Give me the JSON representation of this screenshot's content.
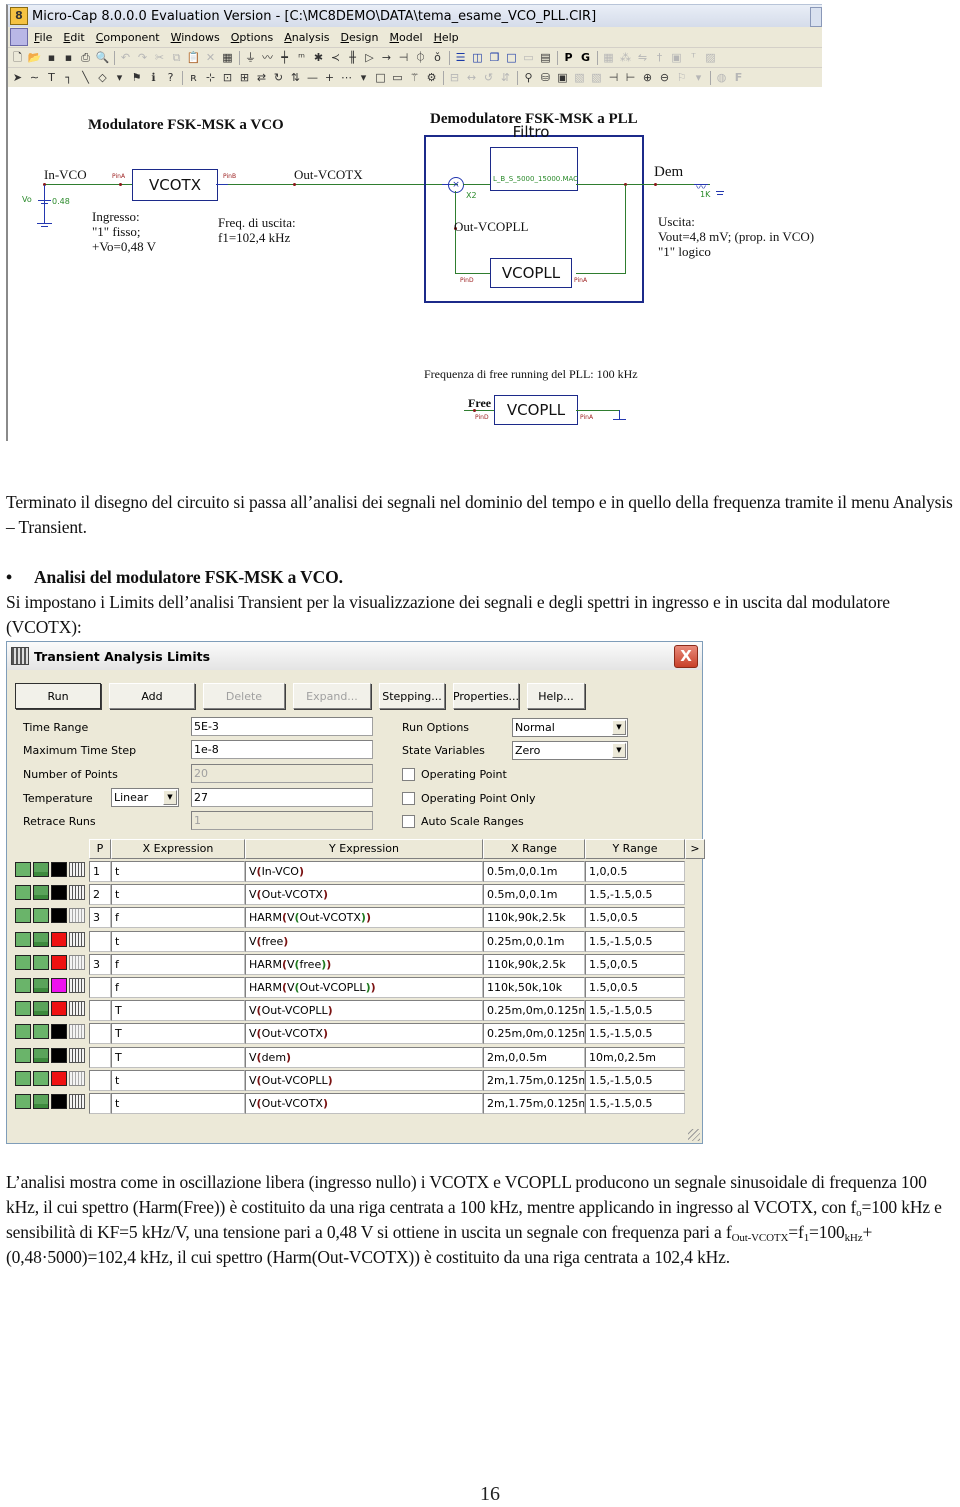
{
  "microcap": {
    "title": "Micro-Cap 8.0.0.0 Evaluation Version - [C:\\MC8DEMO\\DATA\\tema_esame_VCO_PLL.CIR]",
    "app_icon": "8",
    "menu": [
      "File",
      "Edit",
      "Component",
      "Windows",
      "Options",
      "Analysis",
      "Design",
      "Model",
      "Help"
    ],
    "toolbar1": [
      "new-icon",
      "open-icon",
      "save-icon",
      "save-as-icon",
      "print-icon",
      "print-preview-icon",
      "|",
      "undo-icon",
      "redo-icon",
      "cut-icon",
      "copy-icon",
      "paste-icon",
      "delete-icon",
      "select-all-icon",
      "|",
      "ground-icon",
      "resistor-icon",
      "capacitor-icon",
      "inductor-icon",
      "diode-icon",
      "bjt-icon",
      "mosfet-icon",
      "opamp-icon",
      "source-icon",
      "battery-icon",
      "pulse-icon",
      "jfet-icon",
      "|",
      "tile-horizontal-icon",
      "tile-vertical-icon",
      "cascade-icon",
      "window-icon",
      "window2-icon",
      "calculator-icon",
      "|",
      "P",
      "G",
      "|",
      "grid-icon",
      "pattern-icon",
      "flip-icon",
      "pin-icon",
      "box-icon",
      "text-icon",
      "picture-icon"
    ],
    "toolbar2": [
      "select-arrow-icon",
      "wire-icon",
      "text-tool-icon",
      "bus-icon",
      "line-icon",
      "shape-icon",
      "dropdown-icon",
      "flag-icon",
      "info-icon",
      "help-icon",
      "|",
      "ref-icon",
      "node-icon",
      "probe-icon",
      "attr-icon",
      "swap-icon",
      "rotate-icon",
      "mirror-icon",
      "horizontal-icon",
      "cross-icon",
      "dots-icon",
      "dropdown2-icon",
      "rect-icon",
      "page-icon",
      "wand-icon",
      "props-icon",
      "|",
      "dim1-icon",
      "dim2-icon",
      "dim3-icon",
      "dim4-icon",
      "|",
      "find-icon",
      "binoculars-icon",
      "monitor-icon",
      "dim5-icon",
      "dim6-icon",
      "pin-left-icon",
      "pin-right-icon",
      "zoom-in-icon",
      "zoom-out-icon",
      "flag2-icon",
      "dropdown3-icon",
      "|",
      "color-icon",
      "F"
    ],
    "schematic": {
      "modulator_title": "Modulatore FSK-MSK a VCO",
      "in_vco": "In-VCO",
      "vo_label": "Vo",
      "vo_value": "0.48",
      "vcotx": "VCOTX",
      "pin_a": "PinA",
      "pin_b": "PinB",
      "pin_d": "PinD",
      "out_vcotx": "Out-VCOTX",
      "ingresso": "Ingresso:\n\"1\" fisso;\n+Vo=0,48 V",
      "freq_uscita": "Freq. di uscita:\nf1=102,4 kHz",
      "demod_title": "Demodulatore FSK-MSK a PLL",
      "filtro": "Filtro",
      "filter_macro": "L_B_S_5000_15000.MAC",
      "x2": "X2",
      "dem": "Dem",
      "r_value": "1K",
      "out_vcopll": "Out-VCOPLL",
      "vcopll": "VCOPLL",
      "uscita": "Uscita:\nVout=4,8 mV; (prop. in VCO)\n\"1\" logico",
      "free_running": "Frequenza di free running del PLL: 100 kHz",
      "free": "Free"
    }
  },
  "doc": {
    "para1": "Terminato il disegno del circuito si passa all’analisi dei segnali nel dominio del tempo e in quello della frequenza tramite il menu Analysis – Transient.",
    "bullet_mark": "•",
    "bullet": "Analisi del modulatore FSK-MSK a VCO.",
    "para2": "Si impostano i Limits dell’analisi Transient per la visualizzazione dei segnali e degli spettri in ingresso e in uscita dal modulatore (VCOTX):",
    "para3_a": "L’analisi mostra come in oscillazione libera (ingresso nullo) i VCOTX e VCOPLL producono un segnale sinusoidale di frequenza 100 kHz, il cui spettro (Harm(Free)) è costituito da una riga centrata a 100 kHz, mentre applicando in ingresso al VCOTX, con f",
    "sub_o": "o",
    "para3_b": "=100 kHz e sensibilità di KF=5 kHz/V, una tensione pari a 0,48 V si ottiene in uscita un segnale con frequenza pari a f",
    "sub_out": "Out-VCOTX",
    "para3_c": "=f",
    "sub_1": "1",
    "para3_d": "=100",
    "sub_khz": "kHz",
    "para3_e": "+(0,48·5000)=102,4 kHz, il cui spettro (Harm(Out-VCOTX)) è costituito da una riga centrata a 102,4 kHz.",
    "page_number": "16"
  },
  "dialog": {
    "title": "Transient Analysis Limits",
    "close": "X",
    "buttons": [
      {
        "label": "Run",
        "state": "default"
      },
      {
        "label": "Add",
        "state": "normal"
      },
      {
        "label": "Delete",
        "state": "disabled"
      },
      {
        "label": "Expand...",
        "state": "disabled"
      },
      {
        "label": "Stepping...",
        "state": "normal"
      },
      {
        "label": "Properties...",
        "state": "normal"
      },
      {
        "label": "Help...",
        "state": "normal"
      }
    ],
    "fields": {
      "time_range": {
        "label": "Time Range",
        "value": "5E-3"
      },
      "max_time_step": {
        "label": "Maximum Time Step",
        "value": "1e-8"
      },
      "num_points": {
        "label": "Number of Points",
        "value": "20"
      },
      "temperature": {
        "label": "Temperature",
        "mode": "Linear",
        "value": "27"
      },
      "retrace_runs": {
        "label": "Retrace Runs",
        "value": "1"
      }
    },
    "run_options": {
      "label": "Run Options",
      "value": "Normal"
    },
    "state_variables": {
      "label": "State Variables",
      "value": "Zero"
    },
    "checkboxes": [
      {
        "label": "Operating Point",
        "checked": false
      },
      {
        "label": "Operating Point Only",
        "checked": false
      },
      {
        "label": "Auto Scale Ranges",
        "checked": false
      }
    ],
    "columns": {
      "p": "P",
      "x_expr": "X Expression",
      "y_expr": "Y Expression",
      "x_range": "X Range",
      "y_range": "Y Range",
      "more": ">"
    },
    "rows": [
      {
        "p": "1",
        "x": "t",
        "y": "V(In-VCO)",
        "xr": "0.5m,0,0.1m",
        "yr": "1,0,0.5",
        "color": "#000000",
        "mode": "dark"
      },
      {
        "p": "2",
        "x": "t",
        "y": "V(Out-VCOTX)",
        "xr": "0.5m,0,0.1m",
        "yr": "1.5,-1.5,0.5",
        "color": "#000000",
        "mode": "dark"
      },
      {
        "p": "3",
        "x": "f",
        "y": "HARM(V(Out-VCOTX))",
        "xr": "110k,90k,2.5k",
        "yr": "1.5,0,0.5",
        "color": "#000000",
        "mode": "dim"
      },
      {
        "p": "",
        "x": "t",
        "y": "V(free)",
        "xr": "0.25m,0,0.1m",
        "yr": "1.5,-1.5,0.5",
        "color": "#ee1111",
        "mode": "dark"
      },
      {
        "p": "3",
        "x": "f",
        "y": "HARM(V(free))",
        "xr": "110k,90k,2.5k",
        "yr": "1.5,0,0.5",
        "color": "#ee1111",
        "mode": "dim"
      },
      {
        "p": "",
        "x": "f",
        "y": "HARM(V(Out-VCOPLL))",
        "xr": "110k,50k,10k",
        "yr": "1.5,0,0.5",
        "color": "#ee11ee",
        "mode": "dark"
      },
      {
        "p": "",
        "x": "T",
        "y": "V(Out-VCOPLL)",
        "xr": "0.25m,0m,0.125m",
        "yr": "1.5,-1.5,0.5",
        "color": "#ee1111",
        "mode": "dark"
      },
      {
        "p": "",
        "x": "T",
        "y": "V(Out-VCOTX)",
        "xr": "0.25m,0m,0.125m",
        "yr": "1.5,-1.5,0.5",
        "color": "#000000",
        "mode": "dim"
      },
      {
        "p": "",
        "x": "T",
        "y": "V(dem)",
        "xr": "2m,0,0.5m",
        "yr": "10m,0,2.5m",
        "color": "#000000",
        "mode": "dark"
      },
      {
        "p": "",
        "x": "t",
        "y": "V(Out-VCOPLL)",
        "xr": "2m,1.75m,0.125m",
        "yr": "1.5,-1.5,0.5",
        "color": "#ee1111",
        "mode": "dim"
      },
      {
        "p": "",
        "x": "t",
        "y": "V(Out-VCOTX)",
        "xr": "2m,1.75m,0.125m",
        "yr": "1.5,-1.5,0.5",
        "color": "#000000",
        "mode": "dark"
      }
    ]
  }
}
